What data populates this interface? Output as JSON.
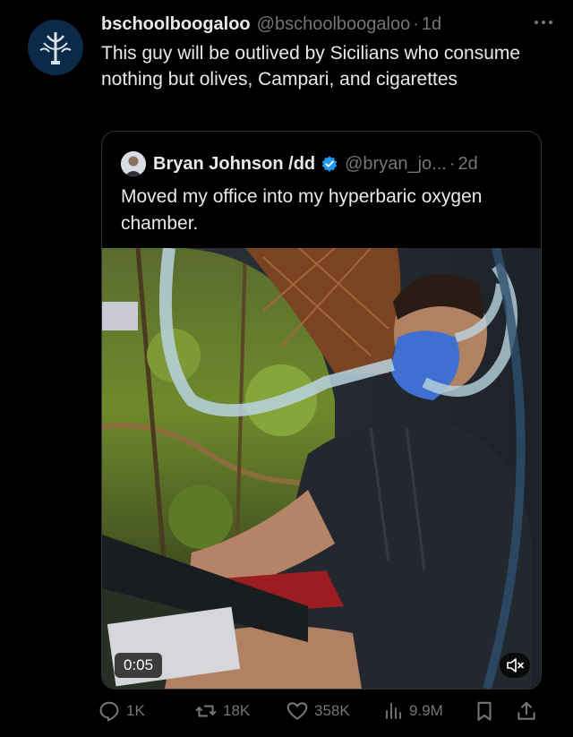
{
  "tweet": {
    "author_name": "bschoolboogaloo",
    "handle": "@bschoolboogaloo",
    "separator": "·",
    "time": "1d",
    "more_icon": "more-horizontal-icon",
    "text": "This guy will be outlived by Sicilians who consume nothing but olives, Campari, and cigarettes"
  },
  "quoted": {
    "author_name": "Bryan Johnson /dd",
    "verified_icon": "verified-badge-icon",
    "handle": "@bryan_jo...",
    "separator": "·",
    "time": "2d",
    "text": "Moved my office into my hyperbaric oxygen chamber.",
    "video": {
      "timestamp": "0:05",
      "mute_icon": "volume-muted-icon"
    }
  },
  "actions": {
    "replies": "1K",
    "reposts": "18K",
    "likes": "358K",
    "views": "9.9M"
  },
  "colors": {
    "background": "#000000",
    "text": "#e7e9ea",
    "secondary": "#71767b",
    "border": "#2f3336",
    "verified": "#1d9bf0"
  }
}
